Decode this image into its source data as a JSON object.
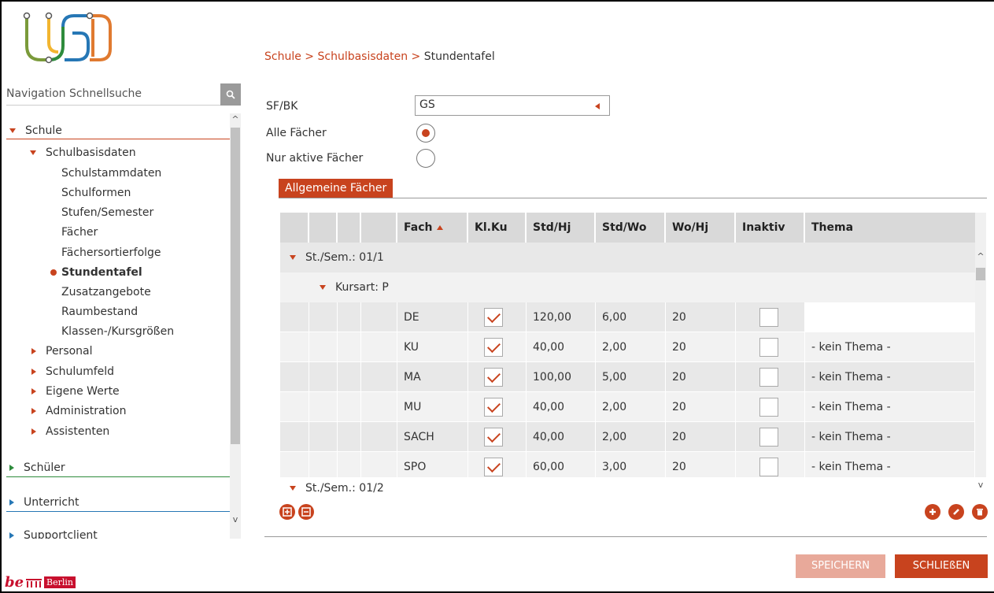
{
  "app": {
    "logo_text": "USD",
    "brand_footer": "Berlin",
    "brand_footer_prefix": "be"
  },
  "nav": {
    "search_placeholder": "Navigation Schnellsuche",
    "items": [
      {
        "label": "Schule"
      },
      {
        "label": "Schulbasisdaten"
      },
      {
        "label": "Schulstammdaten"
      },
      {
        "label": "Schulformen"
      },
      {
        "label": "Stufen/Semester"
      },
      {
        "label": "Fächer"
      },
      {
        "label": "Fächersortierfolge"
      },
      {
        "label": "Stundentafel"
      },
      {
        "label": "Zusatzangebote"
      },
      {
        "label": "Raumbestand"
      },
      {
        "label": "Klassen-/Kursgrößen"
      },
      {
        "label": "Personal"
      },
      {
        "label": "Schulumfeld"
      },
      {
        "label": "Eigene Werte"
      },
      {
        "label": "Administration"
      },
      {
        "label": "Assistenten"
      },
      {
        "label": "Schüler"
      },
      {
        "label": "Unterricht"
      },
      {
        "label": "Supportclient"
      }
    ]
  },
  "breadcrumb": {
    "part1": "Schule",
    "sep": " > ",
    "part2": "Schulbasisdaten",
    "current": "Stundentafel"
  },
  "form": {
    "sfbk_label": "SF/BK",
    "sfbk_value": "GS",
    "alle_label": "Alle Fächer",
    "aktive_label": "Nur aktive Fächer"
  },
  "tab": {
    "label": "Allgemeine Fächer"
  },
  "grid": {
    "headers": {
      "fach": "Fach",
      "klku": "Kl.Ku",
      "stdhj": "Std/Hj",
      "stdwo": "Std/Wo",
      "wohj": "Wo/Hj",
      "inaktiv": "Inaktiv",
      "thema": "Thema"
    },
    "group1": "St./Sem.: 01/1",
    "subgroup1": "Kursart: P",
    "rows": [
      {
        "fach": "DE",
        "klku": true,
        "stdhj": "120,00",
        "stdwo": "6,00",
        "wohj": "20",
        "inaktiv": false,
        "thema": ""
      },
      {
        "fach": "KU",
        "klku": true,
        "stdhj": "40,00",
        "stdwo": "2,00",
        "wohj": "20",
        "inaktiv": false,
        "thema": "- kein Thema -"
      },
      {
        "fach": "MA",
        "klku": true,
        "stdhj": "100,00",
        "stdwo": "5,00",
        "wohj": "20",
        "inaktiv": false,
        "thema": "- kein Thema -"
      },
      {
        "fach": "MU",
        "klku": true,
        "stdhj": "40,00",
        "stdwo": "2,00",
        "wohj": "20",
        "inaktiv": false,
        "thema": "- kein Thema -"
      },
      {
        "fach": "SACH",
        "klku": true,
        "stdhj": "40,00",
        "stdwo": "2,00",
        "wohj": "20",
        "inaktiv": false,
        "thema": "- kein Thema -"
      },
      {
        "fach": "SPO",
        "klku": true,
        "stdhj": "60,00",
        "stdwo": "3,00",
        "wohj": "20",
        "inaktiv": false,
        "thema": "- kein Thema -"
      }
    ],
    "group2": "St./Sem.: 01/2"
  },
  "buttons": {
    "save": "SPEICHERN",
    "close": "SCHLIEßEN"
  },
  "colors": {
    "accent": "#c8431e",
    "green": "#2e8b3c",
    "blue": "#2677b5"
  }
}
